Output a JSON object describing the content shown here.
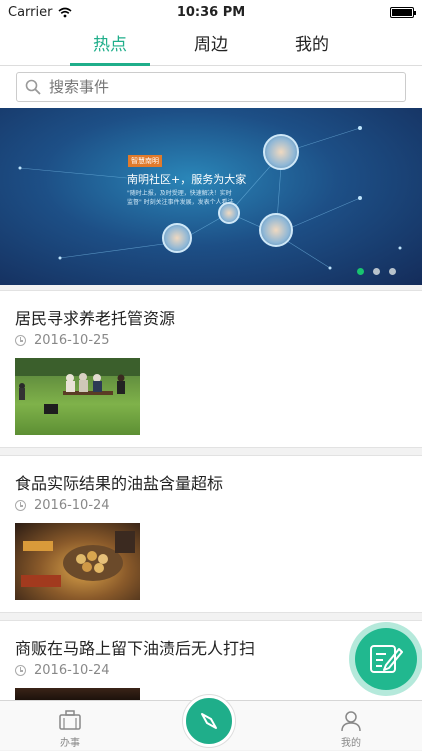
{
  "status_bar": {
    "carrier": "Carrier",
    "time": "10:36 PM"
  },
  "top_tabs": [
    {
      "label": "热点",
      "active": true
    },
    {
      "label": "周边",
      "active": false
    },
    {
      "label": "我的",
      "active": false
    }
  ],
  "search": {
    "placeholder": "搜索事件"
  },
  "banner": {
    "tag": "智慧南明",
    "slogan": "南明社区+，服务为大家",
    "subtext": "\"随时上报，及时受理，快速解决！实时监督\" 时刻关注事件发展，发表个人看法",
    "page_count": 3,
    "active_page": 1
  },
  "news": [
    {
      "title": "居民寻求养老托管资源",
      "date": "2016-10-25"
    },
    {
      "title": "食品实际结果的油盐含量超标",
      "date": "2016-10-24"
    },
    {
      "title": "商贩在马路上留下油渍后无人打扫",
      "date": "2016-10-24"
    }
  ],
  "bottom_tabs": [
    {
      "label": "办事",
      "icon": "briefcase-icon"
    },
    {
      "label": "",
      "icon": "compass-icon"
    },
    {
      "label": "我的",
      "icon": "person-icon"
    }
  ],
  "colors": {
    "accent": "#1fae8a",
    "fab": "#21b88f",
    "active_dot": "#18c46f"
  }
}
